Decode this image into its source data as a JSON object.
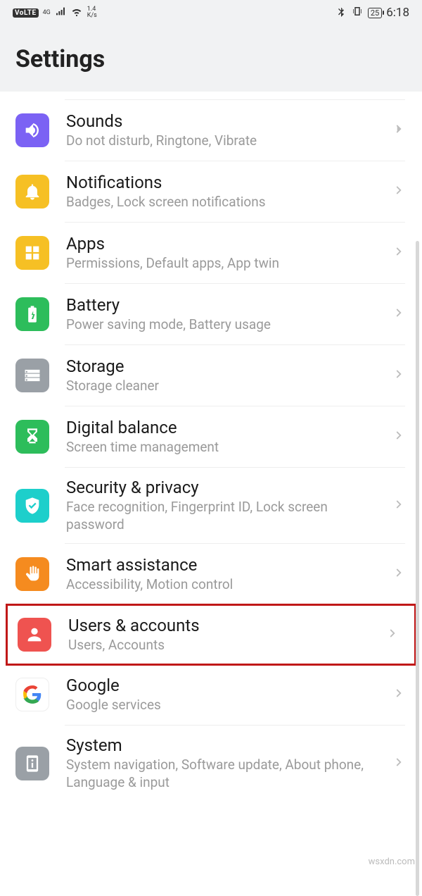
{
  "status": {
    "volte": "VoLTE",
    "net": "4G",
    "speed_top": "1.4",
    "speed_bot": "K/s",
    "battery": "25",
    "time": "6:18"
  },
  "header": {
    "title": "Settings"
  },
  "items": [
    {
      "key": "sounds",
      "title": "Sounds",
      "subtitle": "Do not disturb, Ringtone, Vibrate",
      "color": "#7b62f4"
    },
    {
      "key": "notifications",
      "title": "Notifications",
      "subtitle": "Badges, Lock screen notifications",
      "color": "#f6c024"
    },
    {
      "key": "apps",
      "title": "Apps",
      "subtitle": "Permissions, Default apps, App twin",
      "color": "#f6c024"
    },
    {
      "key": "battery",
      "title": "Battery",
      "subtitle": "Power saving mode, Battery usage",
      "color": "#2dbd5b"
    },
    {
      "key": "storage",
      "title": "Storage",
      "subtitle": "Storage cleaner",
      "color": "#9aa0a6"
    },
    {
      "key": "digital-balance",
      "title": "Digital balance",
      "subtitle": "Screen time management",
      "color": "#2dbd5b"
    },
    {
      "key": "security-privacy",
      "title": "Security & privacy",
      "subtitle": "Face recognition, Fingerprint ID, Lock screen password",
      "color": "#1dcfcb"
    },
    {
      "key": "smart-assistance",
      "title": "Smart assistance",
      "subtitle": "Accessibility, Motion control",
      "color": "#f58b1f"
    },
    {
      "key": "users-accounts",
      "title": "Users & accounts",
      "subtitle": "Users, Accounts",
      "color": "#ef5350",
      "highlighted": true
    },
    {
      "key": "google",
      "title": "Google",
      "subtitle": "Google services",
      "color": "#ffffff"
    },
    {
      "key": "system",
      "title": "System",
      "subtitle": "System navigation, Software update, About phone, Language & input",
      "color": "#9aa0a6"
    }
  ],
  "watermark": "wsxdn.com"
}
